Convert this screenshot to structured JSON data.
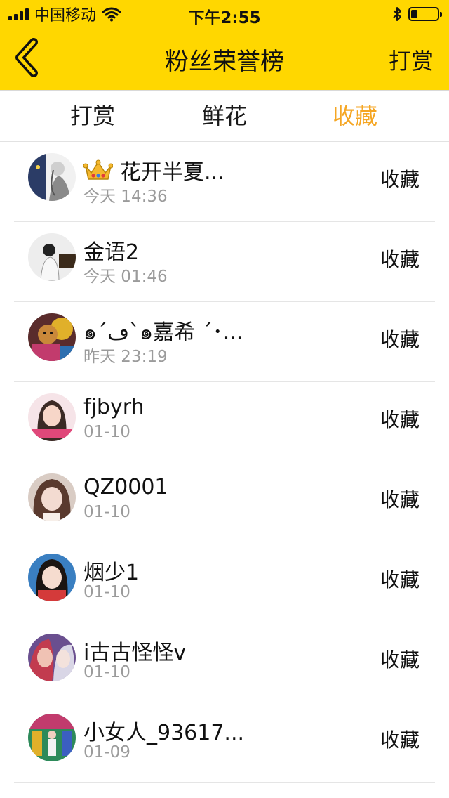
{
  "status_bar": {
    "carrier": "中国移动",
    "time": "下午2:55",
    "battery_level": 0.25
  },
  "nav": {
    "title": "粉丝荣誉榜",
    "action_label": "打赏",
    "accent_color": "#ffd700"
  },
  "tabs": [
    {
      "label": "打赏",
      "active": false
    },
    {
      "label": "鲜花",
      "active": false
    },
    {
      "label": "收藏",
      "active": true,
      "color": "#f5a623"
    }
  ],
  "fans": [
    {
      "name": "花开半夏...",
      "date": "今天 14:36",
      "action": "收藏",
      "badge": "crown-icon"
    },
    {
      "name": "金语2",
      "date": "今天 01:46",
      "action": "收藏"
    },
    {
      "name": "๑´ڡ`๑嘉希 ´･...",
      "date": "昨天 23:19",
      "action": "收藏"
    },
    {
      "name": "fjbyrh",
      "date": "01-10",
      "action": "收藏"
    },
    {
      "name": "QZ0001",
      "date": "01-10",
      "action": "收藏"
    },
    {
      "name": "烟少1",
      "date": "01-10",
      "action": "收藏"
    },
    {
      "name": "i古古怪怪v",
      "date": "01-10",
      "action": "收藏"
    },
    {
      "name": "小女人_93617...",
      "date": "01-09",
      "action": "收藏"
    }
  ]
}
